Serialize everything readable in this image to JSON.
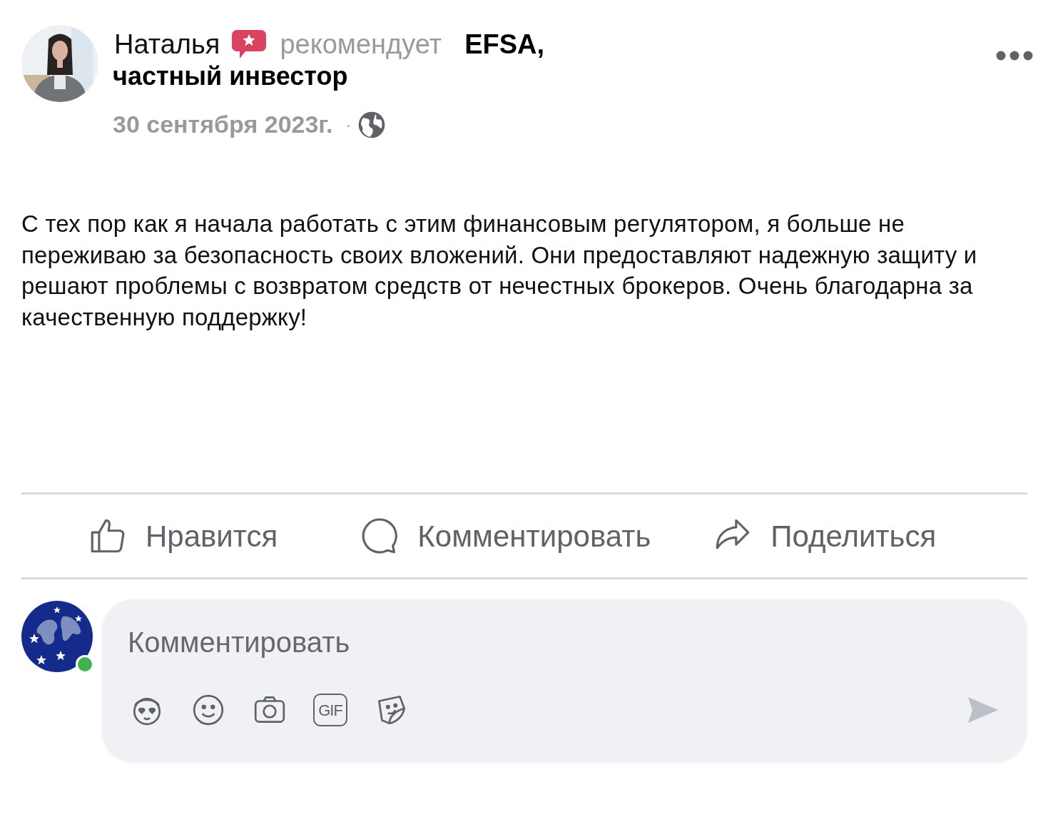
{
  "post": {
    "author": "Наталья",
    "action": "рекомендует",
    "target": "EFSA,",
    "subtitle": "частный инвестор",
    "date": "30 сентября 2023г.",
    "separator": "·",
    "text": "С тех пор как я начала работать с этим финансовым регулятором, я больше не переживаю за безопасность своих вложений. Они предоставляют надежную защиту и решают проблемы с возвратом средств от нечестных брокеров. Очень благодарна за качественную поддержку!"
  },
  "actions": [
    {
      "kind": "like",
      "label": "Нравится"
    },
    {
      "kind": "comment",
      "label": "Комментировать"
    },
    {
      "kind": "share",
      "label": "Поделиться"
    }
  ],
  "composer": {
    "online": true,
    "placeholder": "Комментировать",
    "gif_label": "GIF"
  }
}
